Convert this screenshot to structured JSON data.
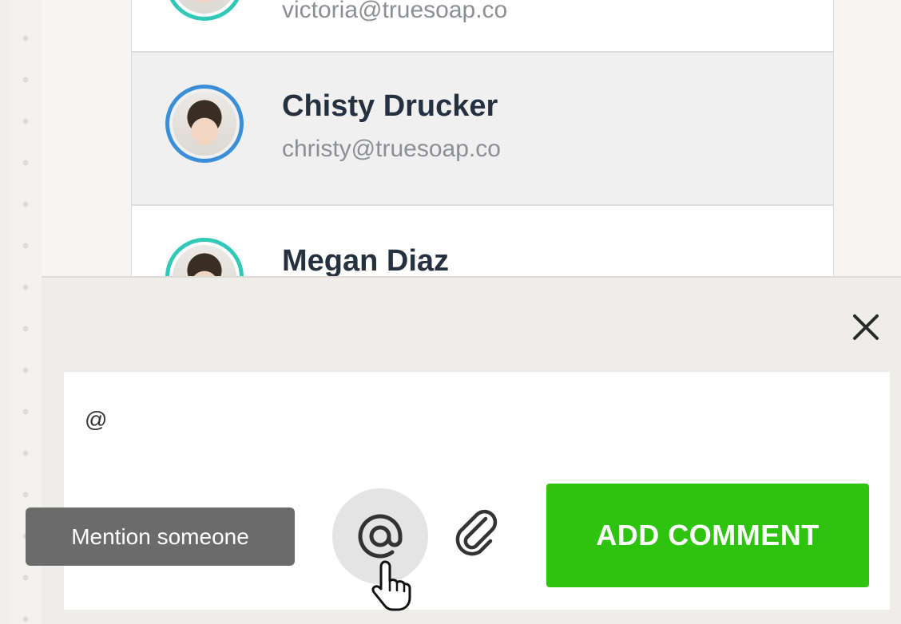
{
  "mention_list": {
    "items": [
      {
        "name": "",
        "email": "victoria@truesoap.co",
        "selected": false
      },
      {
        "name": "Chisty Drucker",
        "email": "christy@truesoap.co",
        "selected": true
      },
      {
        "name": "Megan Diaz",
        "email": "",
        "selected": false
      }
    ]
  },
  "comment": {
    "text": "@",
    "close_icon": "close-icon",
    "mention_icon": "at-sign-icon",
    "attach_icon": "paperclip-icon",
    "add_label": "ADD COMMENT",
    "tooltip": "Mention someone"
  },
  "colors": {
    "accent_green": "#2ec30e",
    "avatar_blue": "#3b8fd9",
    "avatar_teal": "#31c8b8"
  }
}
